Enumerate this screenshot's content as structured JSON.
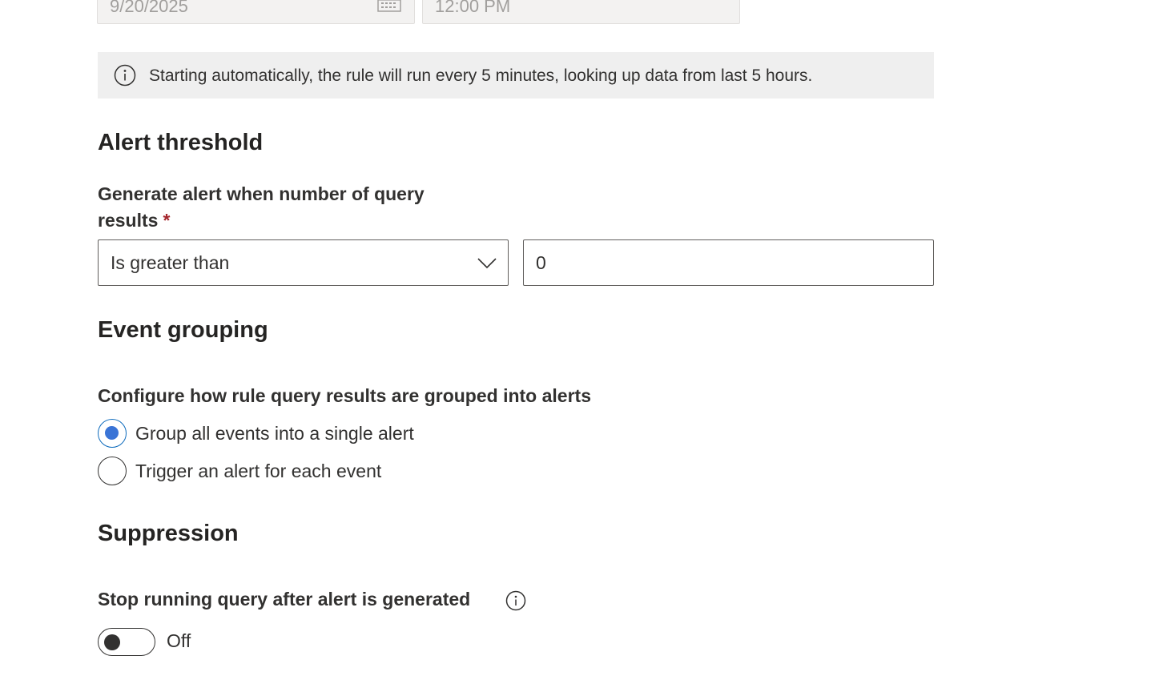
{
  "schedule": {
    "start_date": "9/20/2025",
    "start_time": "12:00 PM"
  },
  "info_banner": {
    "text": "Starting automatically, the rule will run every 5 minutes, looking up data from last 5 hours."
  },
  "alert_threshold": {
    "title": "Alert threshold",
    "label": "Generate alert when number of query results",
    "required_mark": "*",
    "operator_value": "Is greater than",
    "count_value": "0"
  },
  "event_grouping": {
    "title": "Event grouping",
    "label": "Configure how rule query results are grouped into alerts",
    "options": [
      {
        "label": "Group all events into a single alert",
        "selected": true
      },
      {
        "label": "Trigger an alert for each event",
        "selected": false
      }
    ]
  },
  "suppression": {
    "title": "Suppression",
    "label": "Stop running query after alert is generated",
    "toggle_state": "Off"
  }
}
